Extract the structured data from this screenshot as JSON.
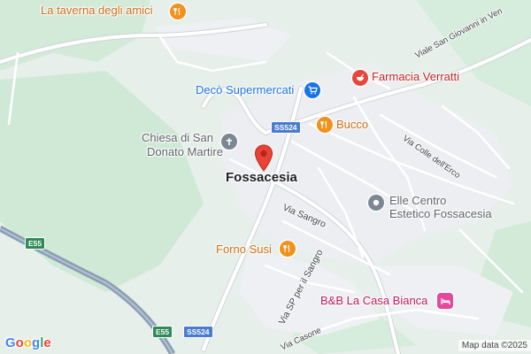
{
  "map": {
    "colors": {
      "land": "#e6efe9",
      "vegetation": "#cfe9d6",
      "urban": "#eceef1",
      "road": "#ffffff",
      "highway": "#8c9eb4",
      "food_icon": "#f2911b",
      "shop_icon": "#1a73e8",
      "pharmacy_icon": "#e8453c",
      "lodging_icon": "#e7489b",
      "generic_icon": "#7b8792",
      "food_label": "#d06b12",
      "shop_label": "#1a73e8",
      "pharmacy_label": "#c5221f",
      "lodging_label": "#c2185b",
      "generic_label": "#5f6368",
      "marker": "#ea4335"
    },
    "town": {
      "name": "Fossacesia",
      "marker_icon": "red-map-pin-icon"
    },
    "pois": [
      {
        "id": "taverna",
        "name": "La taverna degli amici",
        "category": "restaurant",
        "icon": "fork-knife-icon"
      },
      {
        "id": "deco",
        "name": "Decò Supermercati",
        "category": "shopping",
        "icon": "shopping-cart-icon"
      },
      {
        "id": "farmacia",
        "name": "Farmacia Verratti",
        "category": "pharmacy",
        "icon": "mortar-pestle-icon"
      },
      {
        "id": "bucco",
        "name": "Bucco",
        "category": "restaurant",
        "icon": "fork-knife-icon"
      },
      {
        "id": "chiesa",
        "name_line1": "Chiesa di San",
        "name_line2": "Donato Martire",
        "category": "church",
        "icon": "cross-icon"
      },
      {
        "id": "elle",
        "name_line1": "Elle Centro",
        "name_line2": "Estetico Fossacesia",
        "category": "beauty",
        "icon": "circle-dot-icon"
      },
      {
        "id": "forno",
        "name": "Forno Susi",
        "category": "restaurant",
        "icon": "fork-knife-icon"
      },
      {
        "id": "bnb",
        "name": "B&B La Casa Bianca",
        "category": "lodging",
        "icon": "bed-icon"
      }
    ],
    "streets": {
      "viale_san_giovanni": "Viale San Giovanni in Ven",
      "via_colle": "Via Colle dell'Erco",
      "via_sangro": "Via Sangro",
      "via_sp": "Via SP per il Sangro",
      "via_casone": "Via Casone"
    },
    "shields": {
      "ss524_top": "SS524",
      "ss524_bottom": "SS524",
      "e55_left": "E55",
      "e55_bottom": "E55"
    },
    "branding": {
      "logo_letters": [
        "G",
        "o",
        "o",
        "g",
        "l",
        "e"
      ],
      "logo_colors": [
        "#4285f4",
        "#ea4335",
        "#fbbc05",
        "#4285f4",
        "#34a853",
        "#ea4335"
      ],
      "attribution": "Map data ©2025"
    }
  }
}
